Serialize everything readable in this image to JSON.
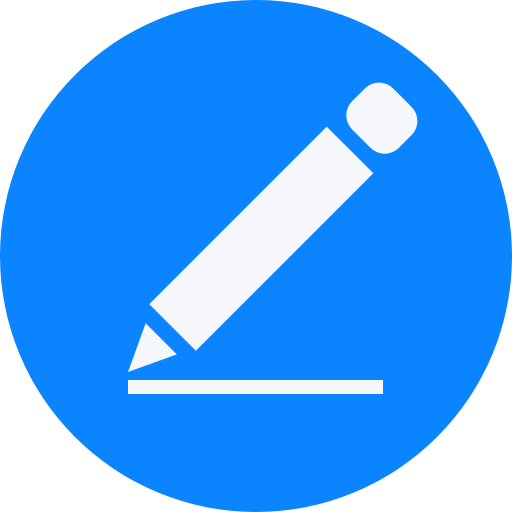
{
  "icon": {
    "name": "edit-pencil-icon",
    "background_color": "#0A84FF",
    "glyph_color": "#F5F7FA"
  }
}
